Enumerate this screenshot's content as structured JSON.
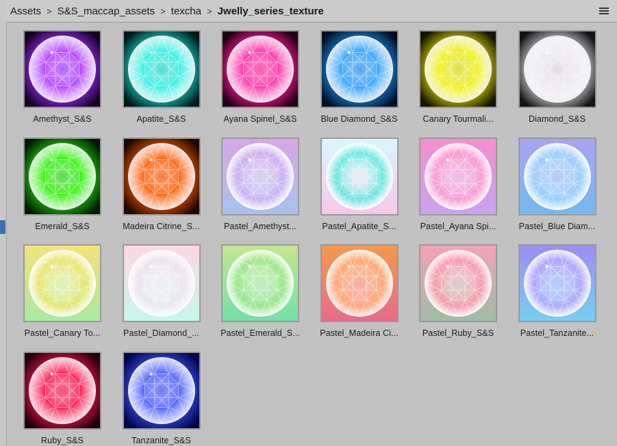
{
  "breadcrumb": {
    "items": [
      "Assets",
      "S&S_maccap_assets",
      "texcha",
      "Jwelly_series_texture"
    ],
    "separator": ">"
  },
  "assets": [
    {
      "label": "Amethyst_S&S",
      "style": "dark",
      "gem": "#b84cff",
      "bg": "#12001f",
      "glow": "#9a2bff"
    },
    {
      "label": "Apatite_S&S",
      "style": "dark",
      "gem": "#3ff2e6",
      "bg": "#001a1a",
      "glow": "#16cfc4"
    },
    {
      "label": "Ayana Spinel_S&S",
      "style": "dark",
      "gem": "#ff3fae",
      "bg": "#1f0012",
      "glow": "#ff1793"
    },
    {
      "label": "Blue Diamond_S&S",
      "style": "dark",
      "gem": "#3fa8ff",
      "bg": "#001022",
      "glow": "#1a86e6"
    },
    {
      "label": "Canary Tourmali...",
      "style": "dark",
      "gem": "#f2f020",
      "bg": "#151500",
      "glow": "#d6d400"
    },
    {
      "label": "Diamond_S&S",
      "style": "dark",
      "gem": "#eeeaf2",
      "bg": "#141414",
      "glow": "#d8d2dc"
    },
    {
      "label": "Emerald_S&S",
      "style": "dark",
      "gem": "#3ef51a",
      "bg": "#001a00",
      "glow": "#22cc10"
    },
    {
      "label": "Madeira Citrine_S...",
      "style": "dark",
      "gem": "#ff6a1a",
      "bg": "#1c0800",
      "glow": "#f05000"
    },
    {
      "label": "Pastel_Amethyst...",
      "style": "pastel",
      "gem": "#cdb3f5",
      "bg": "#d8a6e6",
      "bg2": "#a6c4ee"
    },
    {
      "label": "Pastel_Apatite_S...",
      "style": "pastel",
      "gem": "#5de8e0",
      "bg": "#d9f6ff",
      "bg2": "#f8c8e8"
    },
    {
      "label": "Pastel_Ayana Spi...",
      "style": "pastel",
      "gem": "#ff9ed0",
      "bg": "#f48fcf",
      "bg2": "#c9a3f0"
    },
    {
      "label": "Pastel_Blue Diam...",
      "style": "pastel",
      "gem": "#9fd6ff",
      "bg": "#a9a4f2",
      "bg2": "#74b8ee"
    },
    {
      "label": "Pastel_Canary To...",
      "style": "pastel",
      "gem": "#e9e870",
      "bg": "#f4e27a",
      "bg2": "#a8eaa0"
    },
    {
      "label": "Pastel_Diamond_...",
      "style": "pastel",
      "gem": "#ece6f0",
      "bg": "#ffd6e4",
      "bg2": "#c7f7ea"
    },
    {
      "label": "Pastel_Emerald_S...",
      "style": "pastel",
      "gem": "#9ee88a",
      "bg": "#c4e68e",
      "bg2": "#72e0a8"
    },
    {
      "label": "Pastel_Madeira Ci...",
      "style": "pastel",
      "gem": "#ffb27a",
      "bg": "#f49a4e",
      "bg2": "#e86a8a"
    },
    {
      "label": "Pastel_Ruby_S&S",
      "style": "pastel",
      "gem": "#ff9aae",
      "bg": "#f4a2b6",
      "bg2": "#9fbda4"
    },
    {
      "label": "Pastel_Tanzanite...",
      "style": "pastel",
      "gem": "#b6a8ff",
      "bg": "#9b8ef2",
      "bg2": "#76d0f0"
    },
    {
      "label": "Ruby_S&S",
      "style": "dark",
      "gem": "#ff2a5c",
      "bg": "#1f0008",
      "glow": "#f0104a"
    },
    {
      "label": "Tanzanite_S&S",
      "style": "dark",
      "gem": "#5a6cff",
      "bg": "#00064a",
      "glow": "#3a4cf0"
    }
  ]
}
